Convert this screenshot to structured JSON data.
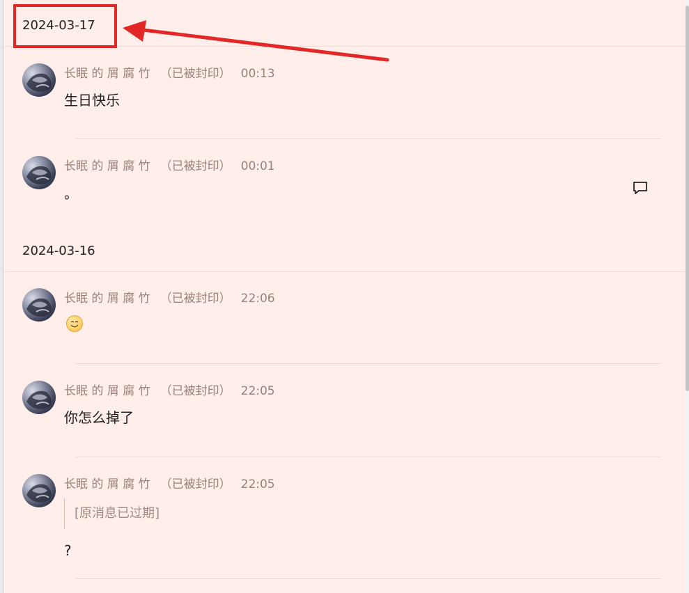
{
  "colors": {
    "panel_bg": "#ffeeea",
    "meta_text": "#9b7f79",
    "annotation": "#e32626"
  },
  "date_groups": [
    {
      "date": "2024-03-17"
    },
    {
      "date": "2024-03-16"
    }
  ],
  "messages": [
    {
      "sender": "长眠 的 屑 腐 竹",
      "status": "（已被封印）",
      "time": "00:13",
      "text": "生日快乐"
    },
    {
      "sender": "长眠 的 屑 腐 竹",
      "status": "（已被封印）",
      "time": "00:01",
      "text": "。",
      "action_icon": "reply-icon"
    },
    {
      "sender": "长眠 的 屑 腐 竹",
      "status": "（已被封印）",
      "time": "22:06",
      "text": "",
      "emoji": "smile-emoji"
    },
    {
      "sender": "长眠 的 屑 腐 竹",
      "status": "（已被封印）",
      "time": "22:05",
      "text": "你怎么掉了"
    },
    {
      "sender": "长眠 的 屑 腐 竹",
      "status": "（已被封印）",
      "time": "22:05",
      "quote": "[原消息已过期]",
      "text": "?"
    }
  ],
  "annotation": {
    "shape": "red-box-with-arrow",
    "target": "date-2024-03-17"
  }
}
